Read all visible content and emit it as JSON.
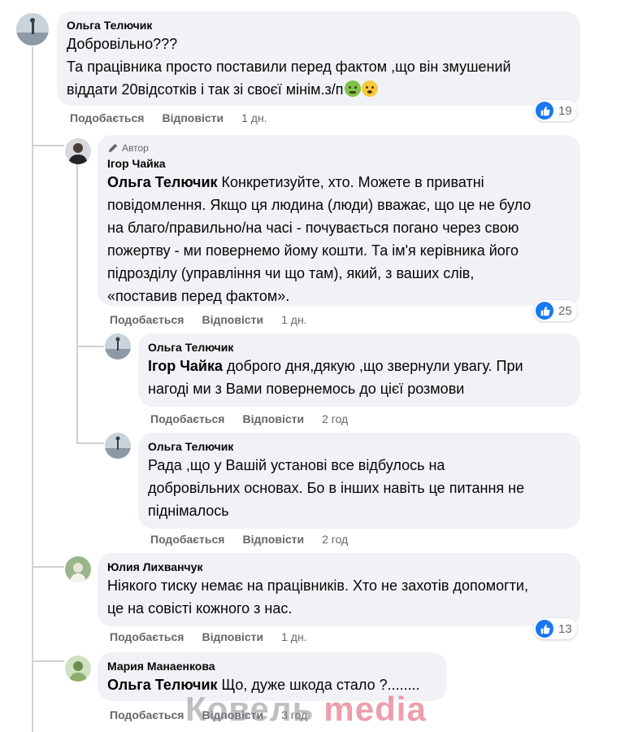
{
  "comments": [
    {
      "author": "Ольга Телючик",
      "lines": [
        "Добровільно???",
        "Та працівника просто поставили перед фактом ,що він змушений",
        "віддати 20відсотків і так зі своєї мінім.з/п"
      ],
      "emojis": [
        "nauseated-face",
        "face-with-steam"
      ],
      "like_label": "Подобається",
      "reply_label": "Відповісти",
      "time": "1 дн.",
      "reactions": "19"
    },
    {
      "author_badge": "Автор",
      "author": "Ігор Чайка",
      "mention": "Ольга Телючик",
      "lines": [
        " Конкретизуйте, хто. Можете в приватні",
        "повідомлення. Якщо ця людина (люди) вважає, що це не було",
        "на благо/правильно/на часі - почувається погано через свою",
        "пожертву - ми повернемо йому кошти. Та ім'я керівника його",
        "підрозділу (управління чи що там), який, з ваших слів,",
        "«поставив перед фактом»."
      ],
      "like_label": "Подобається",
      "reply_label": "Відповісти",
      "time": "1 дн.",
      "reactions": "25"
    },
    {
      "author": "Ольга Телючик",
      "mention": "Ігор Чайка",
      "lines": [
        " доброго дня,дякую ,що звернули увагу. При",
        "нагоді ми з Вами повернемось до цієї розмови"
      ],
      "like_label": "Подобається",
      "reply_label": "Відповісти",
      "time": "2 год"
    },
    {
      "author": "Ольга Телючик",
      "lines": [
        "Рада ,що у Вашій установі все відбулось на",
        "добровільних основах. Бо в інших навіть це питання не",
        "піднімалось"
      ],
      "like_label": "Подобається",
      "reply_label": "Відповісти",
      "time": "2 год"
    },
    {
      "author": "Юлия Лихванчук",
      "lines": [
        "Ніякого тиску немає на працівників. Хто не захотів допомогти,",
        "це на совісті кожного з нас."
      ],
      "like_label": "Подобається",
      "reply_label": "Відповісти",
      "time": "1 дн.",
      "reactions": "13"
    },
    {
      "author": "Мария Манаенкова",
      "mention": "Ольга Телючик",
      "lines": [
        " Що, дуже шкода стало ?........"
      ],
      "like_label": "Подобається",
      "reply_label": "Відповісти",
      "time": "3 год"
    }
  ],
  "watermark": {
    "part1": "Ковель",
    "part2": "media"
  },
  "colors": {
    "bubble": "#f0f2f5",
    "like_blue": "#1877f2",
    "meta_gray": "#65676b",
    "watermark_pink": "#e0506a"
  }
}
